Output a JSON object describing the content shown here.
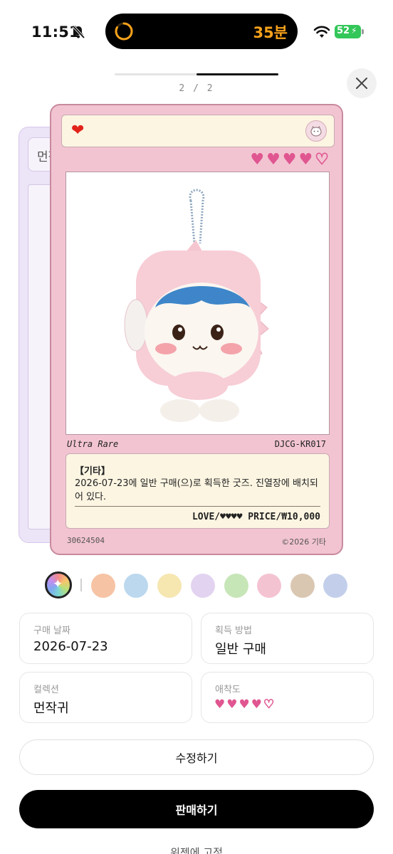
{
  "status": {
    "time": "11:51",
    "timer": "35분",
    "battery": "52"
  },
  "pager": {
    "text": "2 / 2"
  },
  "back_card": {
    "label": "먼작"
  },
  "card": {
    "rarity": "Ultra Rare",
    "code": "DJCG-KR017",
    "category": "【기타】",
    "description": "2026-07-23에 일반 구매(으)로 획득한 굿즈. 진열장에 배치되어 있다.",
    "price_line": "LOVE/♥♥♥♥ PRICE/₩10,000",
    "serial": "30624504",
    "copyright": "©2026 기타",
    "rating": 4,
    "rating_max": 5
  },
  "swatches": [
    "#f6c3a4",
    "#bcd8ee",
    "#f6e6b0",
    "#e2d3f0",
    "#c7e6b8",
    "#f4c3d2",
    "#dac7b2",
    "#c3cfea"
  ],
  "info": {
    "date_label": "구매 날짜",
    "date_value": "2026-07-23",
    "method_label": "획득 방법",
    "method_value": "일반 구매",
    "collection_label": "컬렉션",
    "collection_value": "먼작귀",
    "affection_label": "애착도"
  },
  "actions": {
    "edit": "수정하기",
    "sell": "판매하기",
    "pin": "위젯에 고정"
  },
  "colors": {
    "accent_heart": "#e05690",
    "card_bg": "#f2c4d2",
    "timer": "#f7a21b"
  }
}
